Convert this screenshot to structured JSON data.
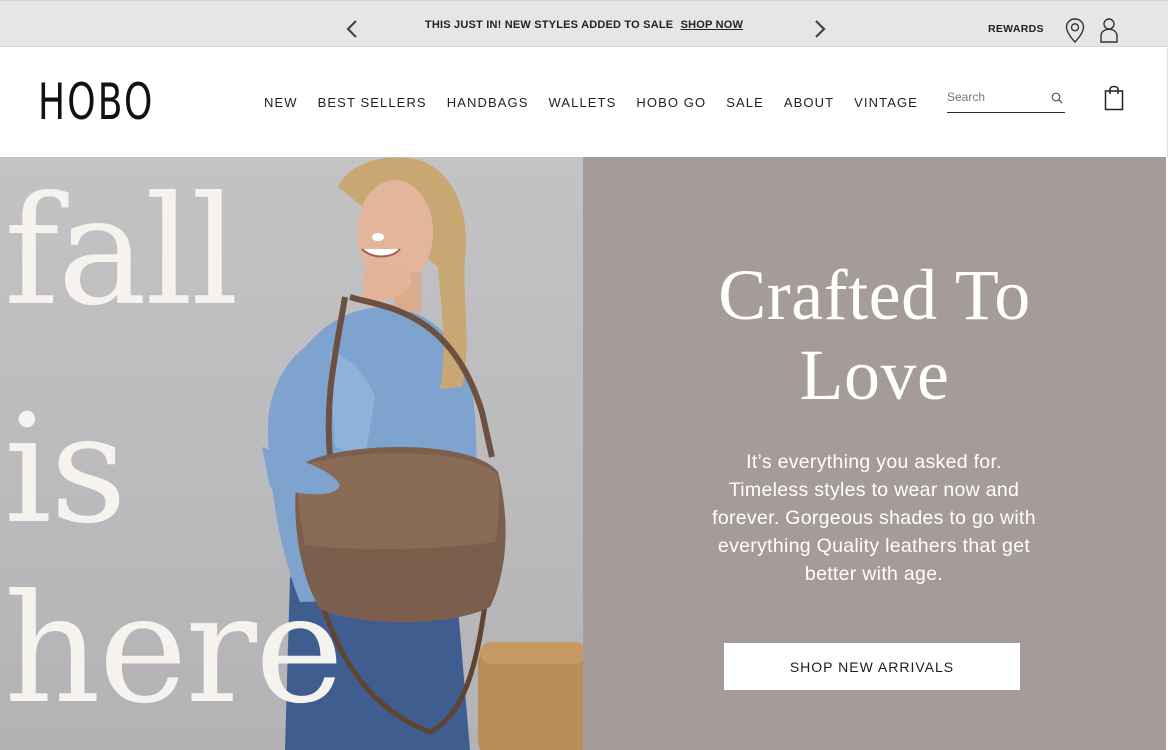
{
  "announcement": {
    "message": "THIS JUST IN! NEW STYLES ADDED TO SALE",
    "link_label": "SHOP NOW"
  },
  "utility_nav": {
    "rewards_label": "REWARDS",
    "icons": [
      "map-pin-icon",
      "account-icon"
    ]
  },
  "header": {
    "logo": "HOBO",
    "nav": [
      "NEW",
      "BEST SELLERS",
      "HANDBAGS",
      "WALLETS",
      "HOBO GO",
      "SALE",
      "ABOUT",
      "VINTAGE"
    ],
    "search": {
      "placeholder": "Search",
      "value": ""
    },
    "icons": [
      "search-icon",
      "shopping-bag-icon"
    ]
  },
  "hero": {
    "overlay_words": [
      "fall",
      "is",
      "here"
    ],
    "heading_line1": "Crafted To",
    "heading_line2": "Love",
    "body": "It’s everything you asked for. Timeless styles to wear now and forever. Gorgeous shades to go with everything Quality leathers that get better with age.",
    "cta_label": "SHOP NEW ARRIVALS"
  },
  "colors": {
    "announcement_bg": "#e6e6e6",
    "hero_panel_bg": "#a59b99",
    "hero_image_bg": "#c0bfc1",
    "text_dark": "#222222",
    "white": "#ffffff"
  }
}
